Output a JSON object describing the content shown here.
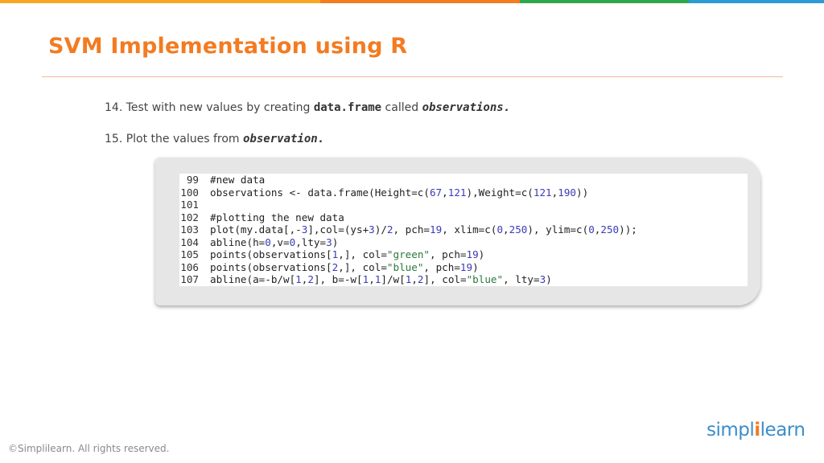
{
  "slide": {
    "title": "SVM Implementation using R",
    "steps": [
      {
        "prefix": "14. Test with new values by creating ",
        "code1": "data.frame",
        "middle": " called ",
        "code2": "observations."
      },
      {
        "prefix": "15. Plot the values from ",
        "code1": "observation."
      }
    ],
    "code_lines": [
      {
        "num": "99",
        "text": "#new data"
      },
      {
        "num": "100",
        "text": "observations <- data.frame(Height=c(67,121),Weight=c(121,190))"
      },
      {
        "num": "101",
        "text": ""
      },
      {
        "num": "102",
        "text": "#plotting the new data"
      },
      {
        "num": "103",
        "text": "plot(my.data[,-3],col=(ys+3)/2, pch=19, xlim=c(0,250), ylim=c(0,250));"
      },
      {
        "num": "104",
        "text": "abline(h=0,v=0,lty=3)"
      },
      {
        "num": "105",
        "text": "points(observations[1,], col=\"green\", pch=19)"
      },
      {
        "num": "106",
        "text": "points(observations[2,], col=\"blue\", pch=19)"
      },
      {
        "num": "107",
        "text": "abline(a=-b/w[1,2], b=-w[1,1]/w[1,2], col=\"blue\", lty=3)"
      }
    ],
    "brand": {
      "part1": "simpl",
      "dot": "i",
      "part2": "learn"
    },
    "copyright": "©Simplilearn. All rights reserved."
  },
  "colors": {
    "title": "#f37b21",
    "topbar": [
      "#f7a823",
      "#f37b21",
      "#2ea84a",
      "#2d9ad6"
    ]
  }
}
